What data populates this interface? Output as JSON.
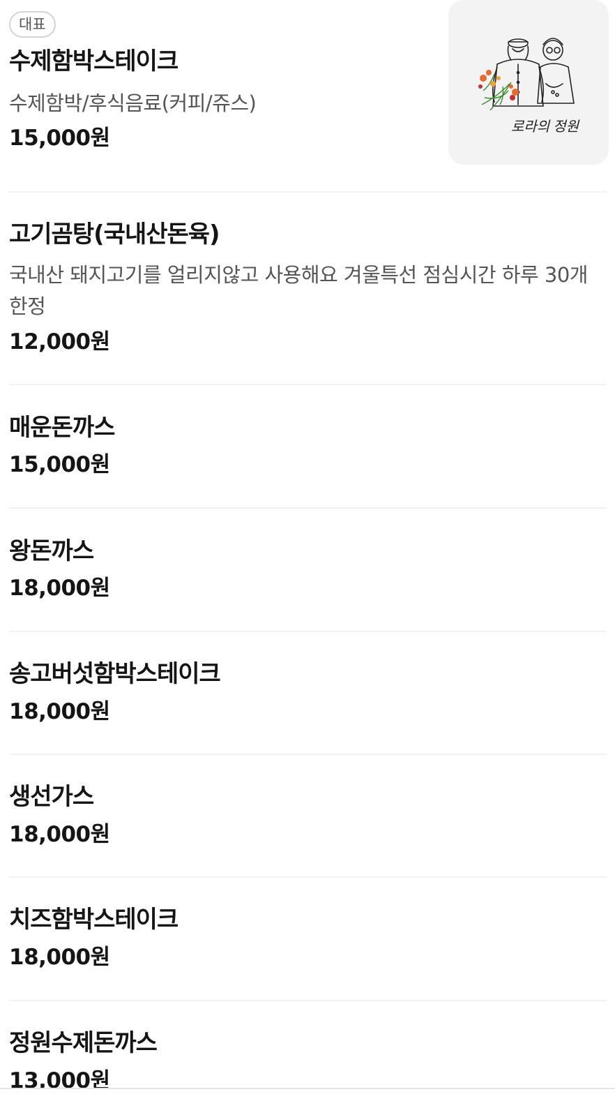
{
  "menu": {
    "items": [
      {
        "badge": "대표",
        "name": "수제함박스테이크",
        "desc": "수제함박/후식음료(커피/쥬스)",
        "price": "15,000원",
        "image_signature": "로라의 정원"
      },
      {
        "name": "고기곰탕(국내산돈육)",
        "desc": "국내산 돼지고기를 얼리지않고 사용해요 겨울특선 점심시간 하루 30개 한정",
        "price": "12,000원"
      },
      {
        "name": "매운돈까스",
        "price": "15,000원"
      },
      {
        "name": "왕돈까스",
        "price": "18,000원"
      },
      {
        "name": "송고버섯함박스테이크",
        "price": "18,000원"
      },
      {
        "name": "생선가스",
        "price": "18,000원"
      },
      {
        "name": "치즈함박스테이크",
        "price": "18,000원"
      },
      {
        "name": "정원수제돈까스",
        "price": "13,000원"
      }
    ]
  }
}
